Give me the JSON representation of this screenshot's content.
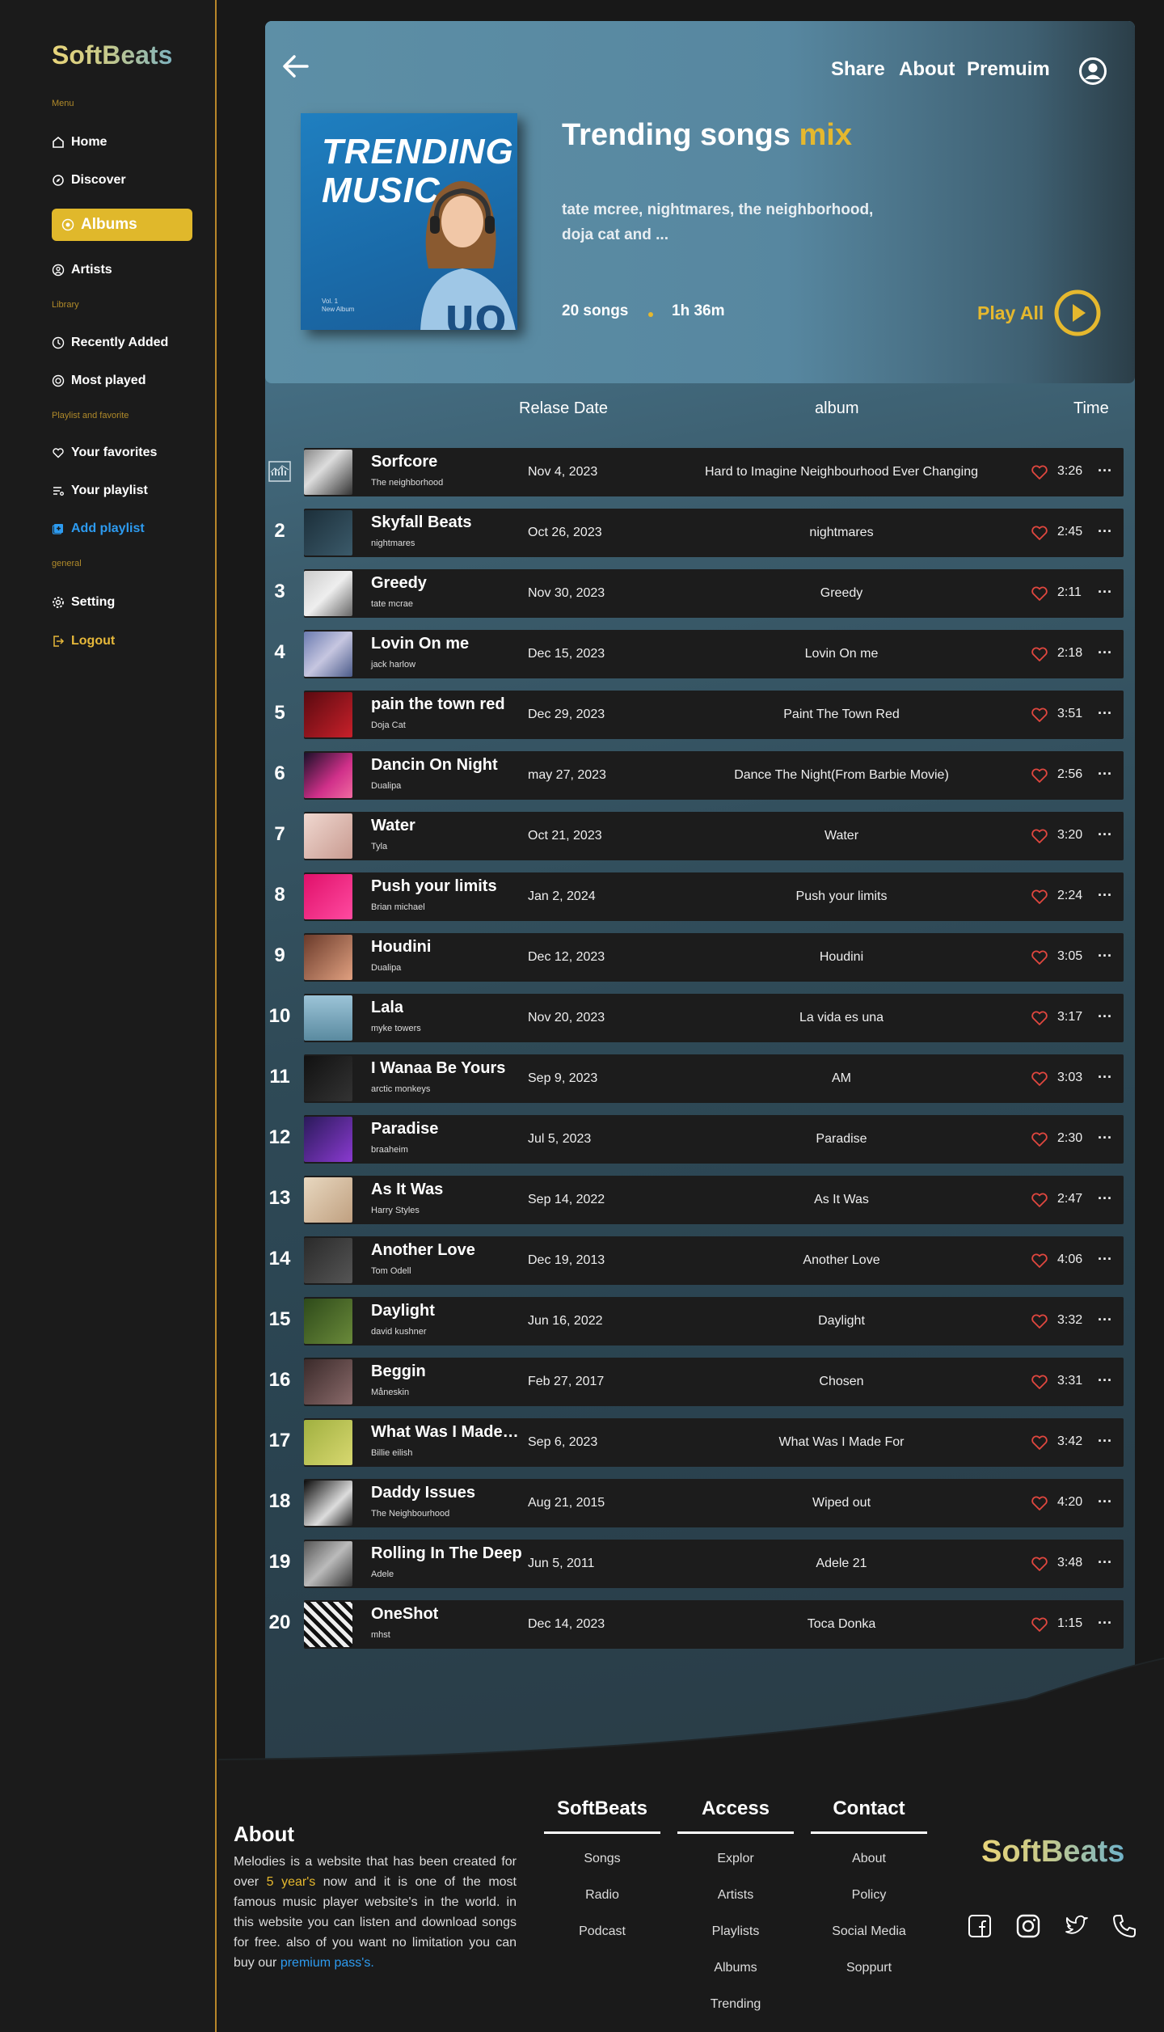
{
  "brand": "SoftBeats",
  "sidebar": {
    "sections": {
      "menu": "Menu",
      "library": "Library",
      "playlist": "Playlist and favorite",
      "general": "general"
    },
    "items": {
      "home": "Home",
      "discover": "Discover",
      "albums": "Albums",
      "artists": "Artists",
      "recent": "Recently Added",
      "most": "Most played",
      "favorites": "Your favorites",
      "playlist": "Your playlist",
      "add": "Add playlist",
      "setting": "Setting",
      "logout": "Logout"
    }
  },
  "header": {
    "nav": {
      "share": "Share",
      "about": "About",
      "premium": "Premuim"
    }
  },
  "hero": {
    "cover_title_1": "TRENDING",
    "cover_title_2": "MUSIC",
    "cover_small_1": "Vol. 1",
    "cover_small_2": "New Album",
    "title": "Trending songs",
    "title_accent": "mix",
    "description": "tate mcree, nightmares, the neighborhood, doja cat and ...",
    "songs": "20 songs",
    "duration": "1h 36m",
    "play_all": "Play All"
  },
  "table": {
    "headers": {
      "release": "Relase Date",
      "album": "album",
      "time": "Time"
    },
    "rows": [
      {
        "num": "",
        "name": "Sorfcore",
        "artist": "The neighborhood",
        "date": "Nov 4, 2023",
        "album": "Hard to Imagine  Neighbourhood Ever Changing",
        "time": "3:26"
      },
      {
        "num": "2",
        "name": "Skyfall Beats",
        "artist": "nightmares",
        "date": "Oct 26, 2023",
        "album": "nightmares",
        "time": "2:45"
      },
      {
        "num": "3",
        "name": "Greedy",
        "artist": "tate mcrae",
        "date": "Nov 30, 2023",
        "album": "Greedy",
        "time": "2:11"
      },
      {
        "num": "4",
        "name": "Lovin On me",
        "artist": "jack harlow",
        "date": "Dec 15, 2023",
        "album": "Lovin On me",
        "time": "2:18"
      },
      {
        "num": "5",
        "name": "pain the town red",
        "artist": "Doja Cat",
        "date": "Dec 29, 2023",
        "album": "Paint The Town Red",
        "time": "3:51"
      },
      {
        "num": "6",
        "name": "Dancin On Night",
        "artist": "Dualipa",
        "date": "may 27, 2023",
        "album": "Dance The Night(From Barbie Movie)",
        "time": "2:56"
      },
      {
        "num": "7",
        "name": "Water",
        "artist": "Tyla",
        "date": "Oct 21, 2023",
        "album": "Water",
        "time": "3:20"
      },
      {
        "num": "8",
        "name": "Push your limits",
        "artist": "Brian michael",
        "date": "Jan 2, 2024",
        "album": "Push your limits",
        "time": "2:24"
      },
      {
        "num": "9",
        "name": "Houdini",
        "artist": "Dualipa",
        "date": "Dec 12, 2023",
        "album": "Houdini",
        "time": "3:05"
      },
      {
        "num": "10",
        "name": "Lala",
        "artist": "myke towers",
        "date": "Nov 20, 2023",
        "album": "La vida es una",
        "time": "3:17"
      },
      {
        "num": "11",
        "name": "I Wanaa Be Yours",
        "artist": "arctic monkeys",
        "date": "Sep 9, 2023",
        "album": "AM",
        "time": "3:03"
      },
      {
        "num": "12",
        "name": "Paradise",
        "artist": "braaheim",
        "date": "Jul 5, 2023",
        "album": "Paradise",
        "time": "2:30"
      },
      {
        "num": "13",
        "name": "As It Was",
        "artist": "Harry Styles",
        "date": "Sep 14, 2022",
        "album": "As It Was",
        "time": "2:47"
      },
      {
        "num": "14",
        "name": "Another Love",
        "artist": "Tom Odell",
        "date": "Dec 19, 2013",
        "album": "Another Love",
        "time": "4:06"
      },
      {
        "num": "15",
        "name": "Daylight",
        "artist": "david kushner",
        "date": "Jun 16, 2022",
        "album": "Daylight",
        "time": "3:32"
      },
      {
        "num": "16",
        "name": "Beggin",
        "artist": "Måneskin",
        "date": "Feb 27, 2017",
        "album": "Chosen",
        "time": "3:31"
      },
      {
        "num": "17",
        "name": "What Was I Made For",
        "artist": "Billie eilish",
        "date": "Sep 6, 2023",
        "album": "What Was I Made For",
        "time": "3:42"
      },
      {
        "num": "18",
        "name": "Daddy Issues",
        "artist": "The Neighbourhood",
        "date": "Aug 21, 2015",
        "album": "Wiped out",
        "time": "4:20"
      },
      {
        "num": "19",
        "name": "Rolling In The Deep",
        "artist": "Adele",
        "date": "Jun 5, 2011",
        "album": "Adele 21",
        "time": "3:48"
      },
      {
        "num": "20",
        "name": "OneShot",
        "artist": "mhst",
        "date": "Dec 14, 2023",
        "album": "Toca Donka",
        "time": "1:15"
      }
    ],
    "more_glyph": "···"
  },
  "footer": {
    "about_title": "About",
    "about_text_1": "Melodies is a website that has been created for over ",
    "about_years": "5 year's",
    "about_text_2": " now and it is one of the most famous music player website's in the world. in this website you can listen and download songs for free. also of you want no limitation you can buy our ",
    "about_link": "premium pass's.",
    "columns": [
      {
        "title": "SoftBeats",
        "links": [
          "Songs",
          "Radio",
          "Podcast"
        ]
      },
      {
        "title": "Access",
        "links": [
          "Explor",
          "Artists",
          "Playlists",
          "Albums",
          "Trending"
        ]
      },
      {
        "title": "Contact",
        "links": [
          "About",
          "Policy",
          "Social Media",
          "Soppurt"
        ]
      }
    ],
    "brand": "SoftBeats",
    "social_icons": [
      "facebook-icon",
      "instagram-icon",
      "twitter-icon",
      "phone-icon"
    ]
  },
  "colors": {
    "accent_gold": "#e5b82e",
    "accent_blue": "#2d9bf0",
    "heart_red": "#e0473f",
    "panel_blue": "#5d8fa6",
    "row_bg": "#1c1c1c"
  }
}
